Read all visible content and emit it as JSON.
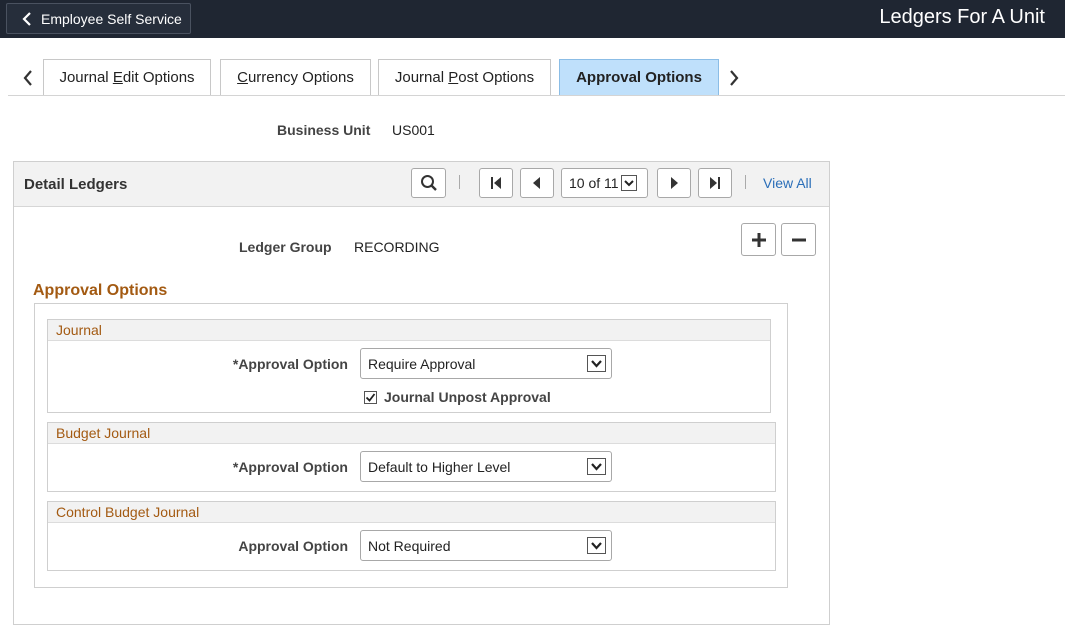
{
  "header": {
    "back_label": "Employee Self Service",
    "page_title": "Ledgers For A Unit"
  },
  "tabs": [
    {
      "pre": "Journal ",
      "key": "E",
      "post": "dit Options"
    },
    {
      "pre": "",
      "key": "C",
      "post": "urrency Options"
    },
    {
      "pre": "Journal ",
      "key": "P",
      "post": "ost Options"
    },
    {
      "label": "Approval Options",
      "active": true
    }
  ],
  "business_unit": {
    "label": "Business Unit",
    "value": "US001"
  },
  "detail_ledgers": {
    "title": "Detail Ledgers",
    "pager": "10 of 11",
    "view_all": "View All",
    "ledger_group_label": "Ledger Group",
    "ledger_group_value": "RECORDING"
  },
  "approval_options": {
    "title": "Approval Options",
    "journal": {
      "heading": "Journal",
      "option_label": "*Approval Option",
      "option_value": "Require Approval",
      "unpost_label": "Journal Unpost Approval",
      "unpost_checked": true
    },
    "budget_journal": {
      "heading": "Budget Journal",
      "option_label": "*Approval Option",
      "option_value": "Default to Higher Level"
    },
    "control_budget_journal": {
      "heading": "Control Budget Journal",
      "option_label": "Approval Option",
      "option_value": "Not Required"
    }
  },
  "colors": {
    "header_bg": "#1f2632",
    "active_tab_bg": "#bfe0fb",
    "section_title": "#a35a12",
    "link": "#2a6eb8"
  }
}
